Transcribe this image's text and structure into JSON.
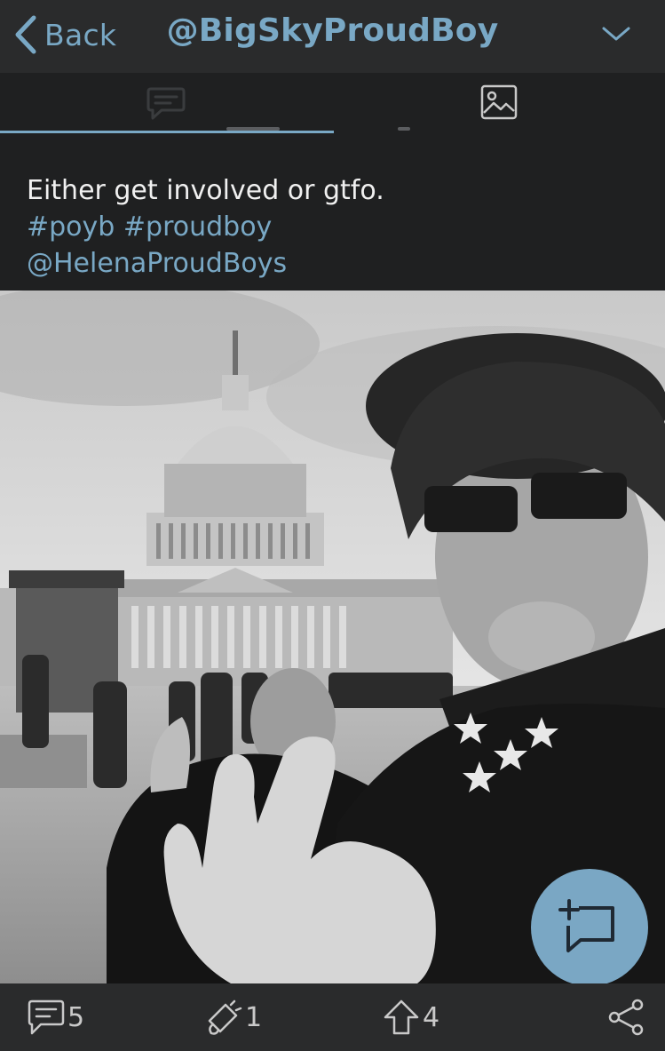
{
  "header": {
    "back_label": "Back",
    "title": "@BigSkyProudBoy",
    "back_icon": "chevron-left-icon",
    "menu_icon": "chevron-down-icon"
  },
  "tabs": [
    {
      "name": "posts",
      "icon": "chat-bubble-icon",
      "active": true
    },
    {
      "name": "media",
      "icon": "image-icon",
      "active": false
    }
  ],
  "post": {
    "text": "Either get involved or gtfo.",
    "hashtags": [
      "#poyb",
      "#proudboy"
    ],
    "mention": "@HelenaProudBoys"
  },
  "actions": {
    "replies": "5",
    "reposts": "1",
    "upvotes": "4",
    "reply_icon": "comment-icon",
    "repost_icon": "megaphone-icon",
    "upvote_icon": "up-arrow-icon",
    "share_icon": "share-icon",
    "compose_icon": "compose-icon"
  },
  "colors": {
    "accent": "#79a8c5",
    "background": "#1f2021",
    "bar": "#2a2b2c",
    "fab": "#7aa7c4"
  }
}
